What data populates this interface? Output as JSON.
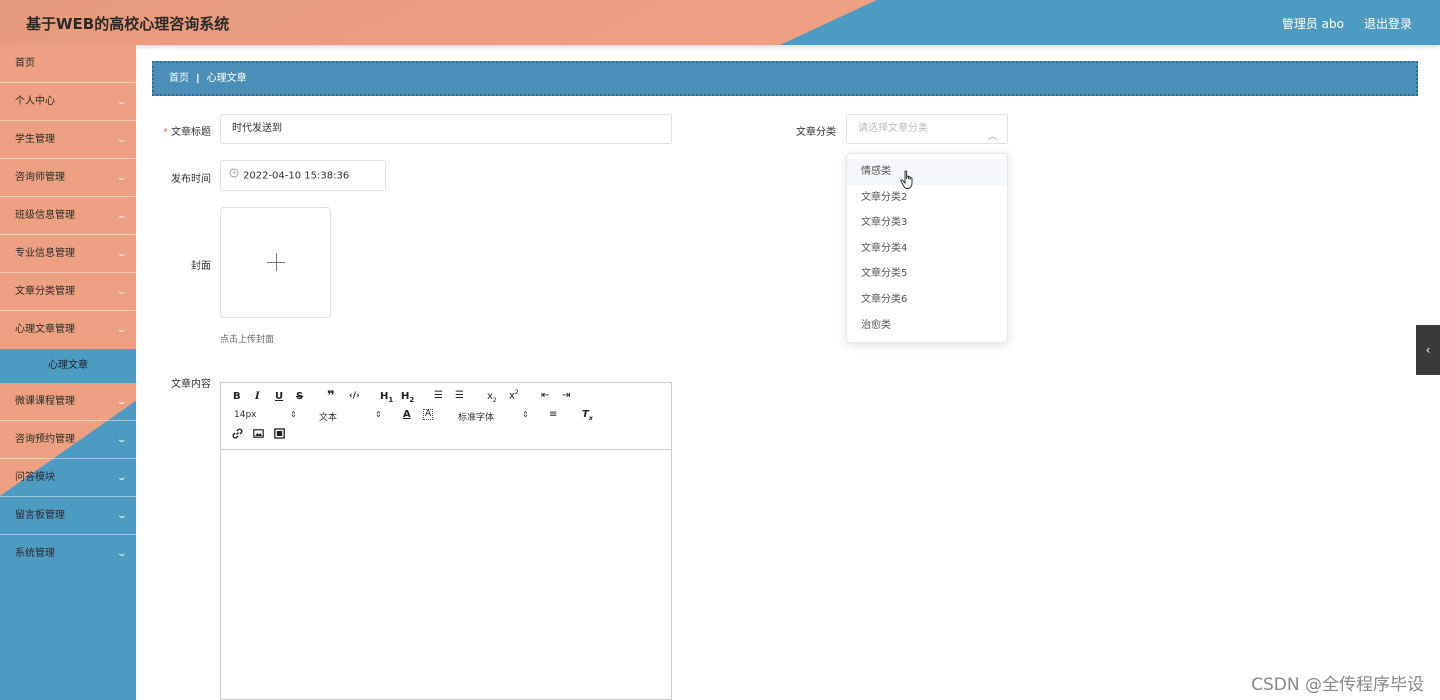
{
  "header": {
    "title": "基于WEB的高校心理咨询系统",
    "admin": "管理员 abo",
    "logout": "退出登录"
  },
  "sidebar": {
    "items": [
      {
        "label": "首页"
      },
      {
        "label": "个人中心"
      },
      {
        "label": "学生管理"
      },
      {
        "label": "咨询师管理"
      },
      {
        "label": "班级信息管理"
      },
      {
        "label": "专业信息管理"
      },
      {
        "label": "文章分类管理"
      },
      {
        "label": "心理文章管理"
      },
      {
        "label": "心理文章"
      },
      {
        "label": "微课课程管理"
      },
      {
        "label": "咨询预约管理"
      },
      {
        "label": "问答模块"
      },
      {
        "label": "留言板管理"
      },
      {
        "label": "系统管理"
      }
    ]
  },
  "breadcrumb": {
    "home": "首页",
    "sep": "|",
    "current": "心理文章"
  },
  "form": {
    "title_label": "文章标题",
    "title_value": "时代发送到",
    "category_label": "文章分类",
    "category_placeholder": "请选择文章分类",
    "time_label": "发布时间",
    "time_value": "2022-04-10 15:38:36",
    "cover_label": "封面",
    "cover_tip": "点击上传封面",
    "content_label": "文章内容"
  },
  "editor": {
    "font_size": "14px",
    "paragraph": "文本",
    "font_family": "标准字体"
  },
  "dropdown": {
    "options": [
      "情感类",
      "文章分类2",
      "文章分类3",
      "文章分类4",
      "文章分类5",
      "文章分类6",
      "治愈类"
    ]
  },
  "watermark": "CSDN @全传程序毕设"
}
